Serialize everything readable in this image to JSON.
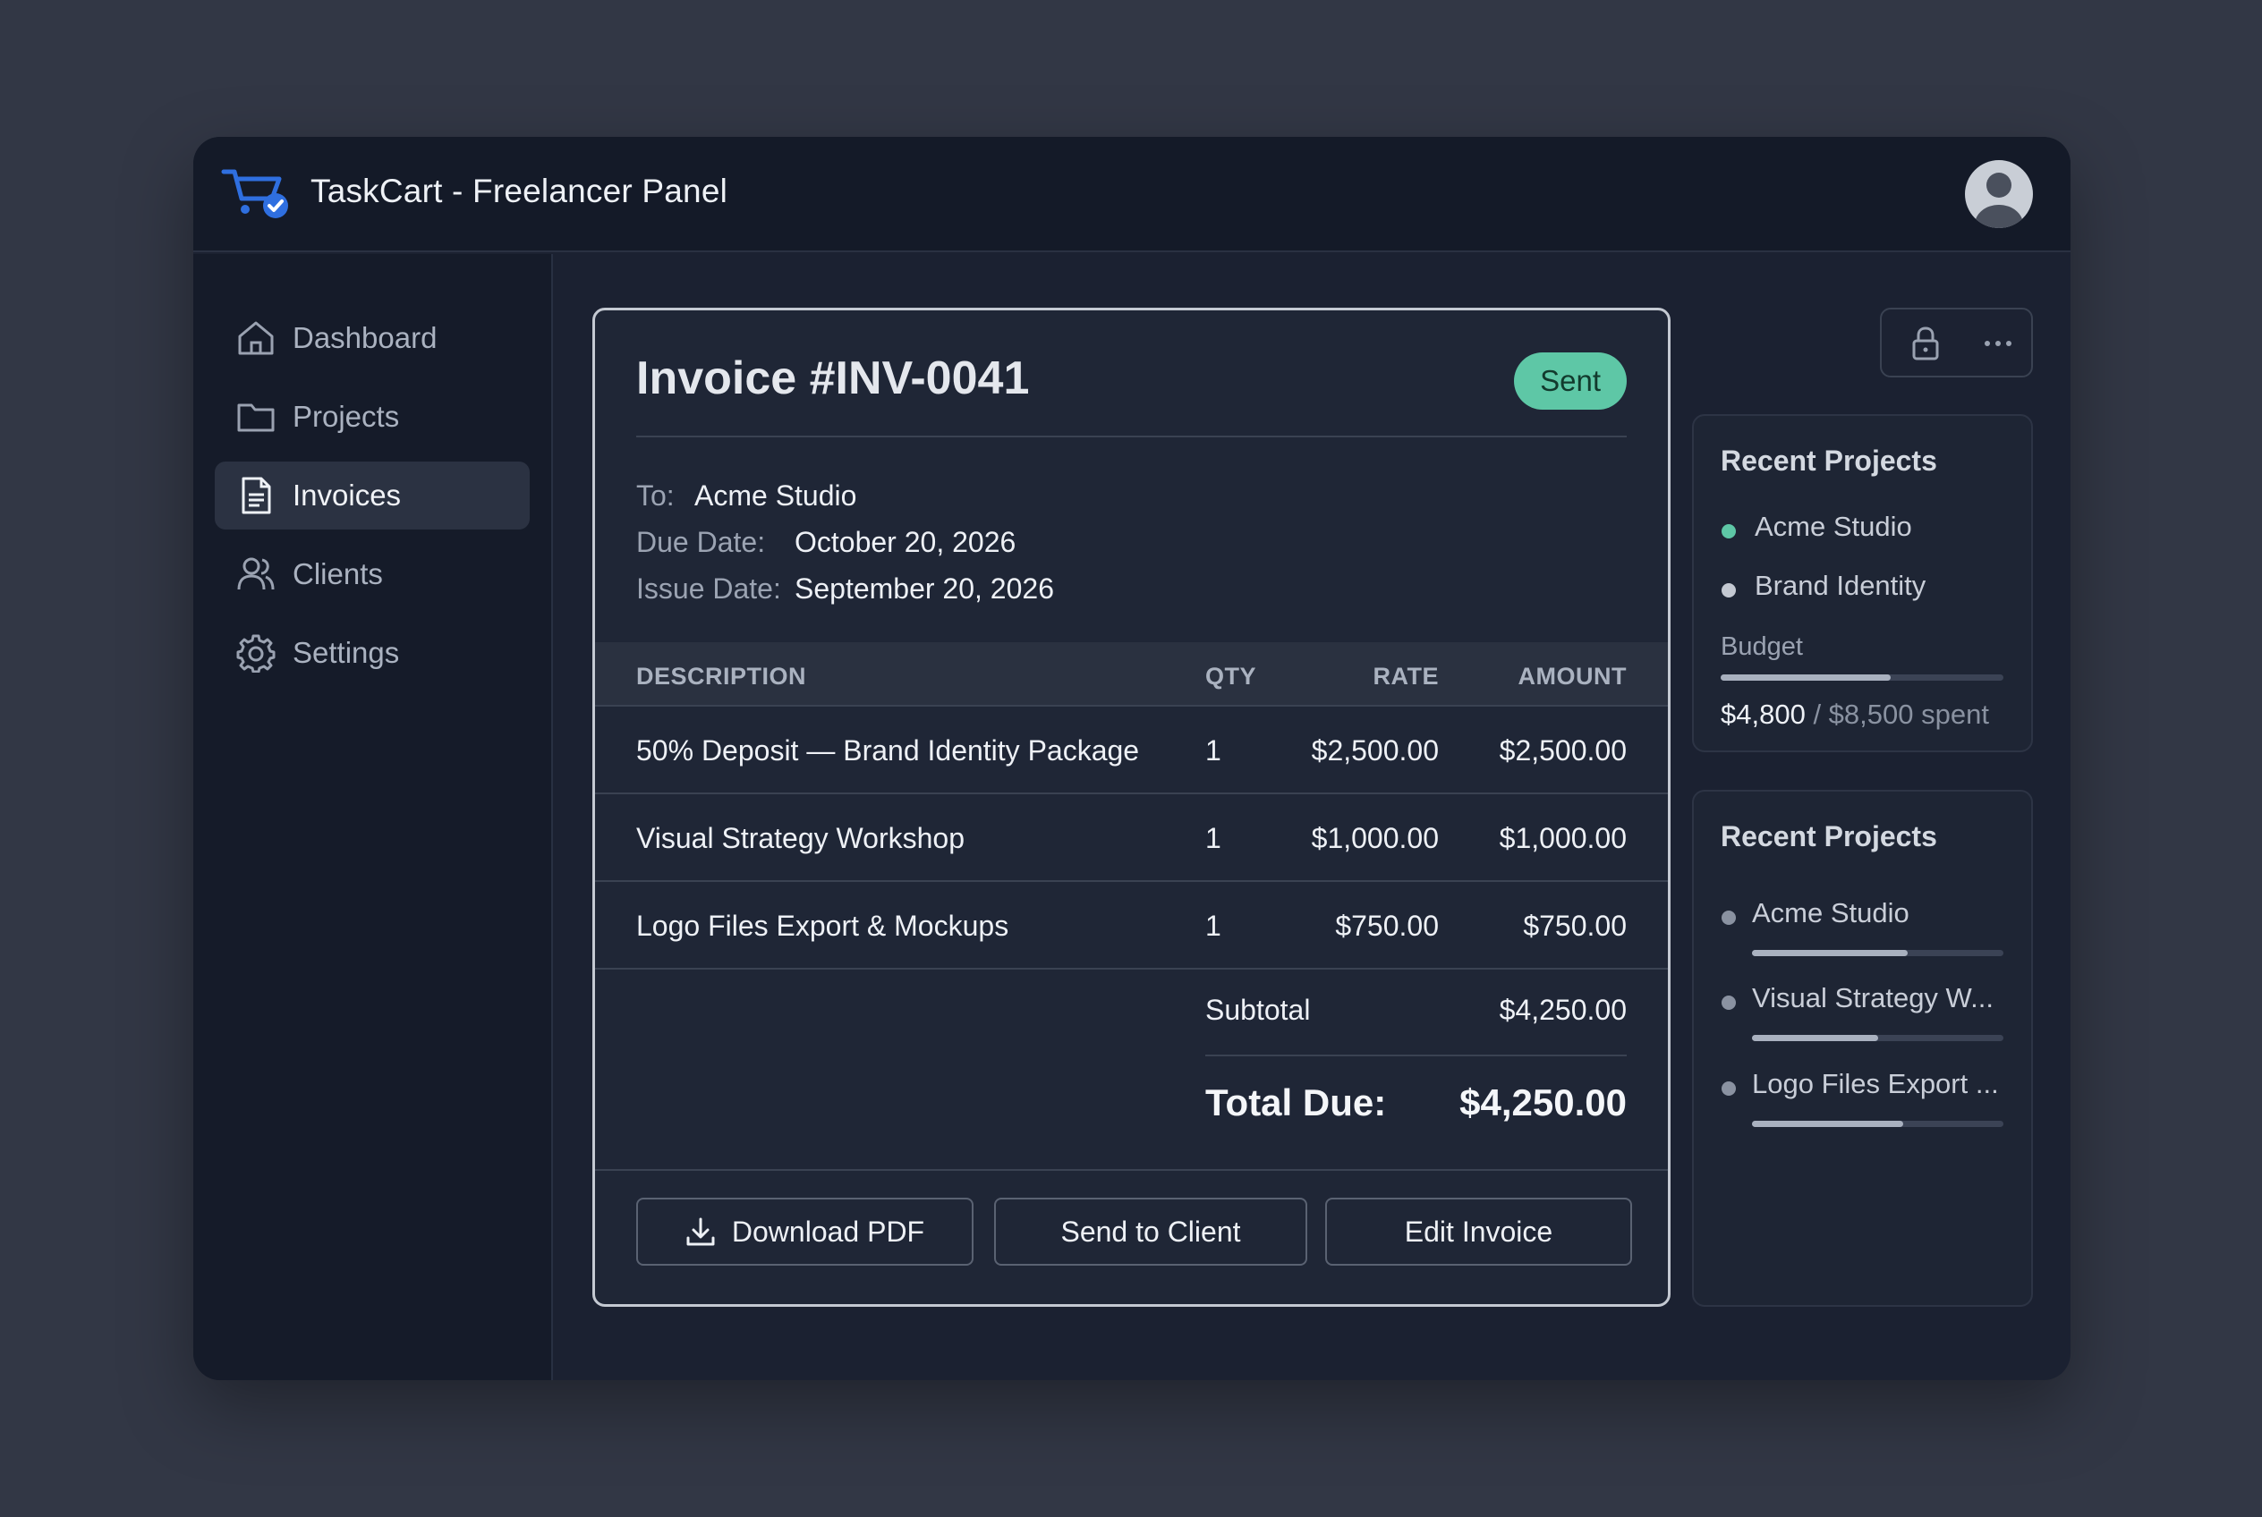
{
  "app": {
    "title": "TaskCart - Freelancer Panel"
  },
  "sidebar": {
    "items": [
      {
        "label": "Dashboard",
        "icon": "home-icon",
        "active": false
      },
      {
        "label": "Projects",
        "icon": "folder-icon",
        "active": false
      },
      {
        "label": "Invoices",
        "icon": "document-icon",
        "active": true
      },
      {
        "label": "Clients",
        "icon": "users-icon",
        "active": false
      },
      {
        "label": "Settings",
        "icon": "gear-icon",
        "active": false
      }
    ]
  },
  "invoice": {
    "title": "Invoice #INV-0041",
    "status": "Sent",
    "to_label": "To:",
    "to_value": "Acme Studio",
    "due_label": "Due Date:",
    "due_value": "October 20, 2026",
    "issue_label": "Issue Date:",
    "issue_value": "September 20, 2026",
    "columns": {
      "description": "DESCRIPTION",
      "qty": "QTY",
      "rate": "RATE",
      "amount": "AMOUNT"
    },
    "line_items": [
      {
        "description": "50% Deposit — Brand Identity Package",
        "qty": "1",
        "rate": "$2,500.00",
        "amount": "$2,500.00"
      },
      {
        "description": "Visual Strategy Workshop",
        "qty": "1",
        "rate": "$1,000.00",
        "amount": "$1,000.00"
      },
      {
        "description": "Logo Files Export & Mockups",
        "qty": "1",
        "rate": "$750.00",
        "amount": "$750.00"
      }
    ],
    "subtotal_label": "Subtotal",
    "subtotal_value": "$4,250.00",
    "total_label": "Total Due:",
    "total_value": "$4,250.00",
    "buttons": {
      "download": "Download PDF",
      "send": "Send to Client",
      "edit": "Edit Invoice"
    }
  },
  "right_panel": {
    "recent_1": {
      "title": "Recent Projects",
      "items": [
        {
          "label": "Acme Studio",
          "dot_color": "#5ec7a6"
        },
        {
          "label": "Brand Identity",
          "dot_color": "#c4c9d2"
        }
      ],
      "budget_label": "Budget",
      "budget_fraction": 0.6,
      "budget_spent": "$4,800",
      "budget_total": "/ $8,500 spent"
    },
    "recent_2": {
      "title": "Recent Projects",
      "items": [
        {
          "label": "Acme Studio",
          "progress": 0.62
        },
        {
          "label": "Visual Strategy W...",
          "progress": 0.5
        },
        {
          "label": "Logo Files Export ...",
          "progress": 0.6
        }
      ]
    }
  },
  "colors": {
    "accent_blue": "#2f6fe0",
    "status_green": "#5ec7a6"
  }
}
